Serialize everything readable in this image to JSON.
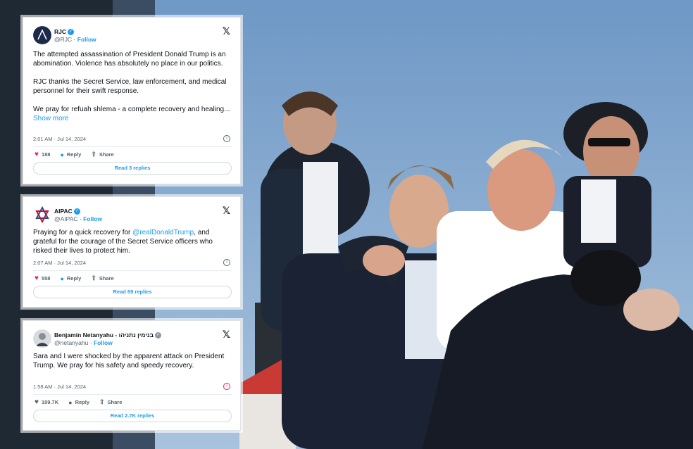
{
  "tweets": [
    {
      "name": "RJC",
      "handle": "@RJC",
      "follow": "Follow",
      "x_logo": "x-logo",
      "paragraphs": [
        "The attempted assassination of President Donald Trump is an abomination. Violence has absolutely no place in our politics.",
        "RJC thanks the Secret Service, law enforcement, and medical personnel for their swift response.",
        "We pray for refuah shlema - a complete recovery and healing..."
      ],
      "show_more": "Show more",
      "timestamp": "2:01 AM · Jul 14, 2024",
      "likes": "188",
      "reply": "Reply",
      "share": "Share",
      "read_replies": "Read 3 replies"
    },
    {
      "name": "AIPAC",
      "handle": "@AIPAC",
      "follow": "Follow",
      "text_before": "Praying for a quick recovery for ",
      "mention": "@realDonaldTrump",
      "text_after": ", and grateful for the courage of the Secret Service officers who risked their lives to protect him.",
      "timestamp": "2:07 AM · Jul 14, 2024",
      "likes": "558",
      "reply": "Reply",
      "share": "Share",
      "read_replies": "Read 69 replies"
    },
    {
      "name": "Benjamin Netanyahu - בנימין נתניהו",
      "handle": "@netanyahu",
      "follow": "Follow",
      "text": "Sara and I were shocked by the apparent attack on President Trump. We pray for his safety and speedy recovery.",
      "timestamp": "1:58 AM · Jul 14, 2024",
      "likes": "109.7K",
      "reply": "Reply",
      "share": "Share",
      "read_replies": "Read 2.7K replies"
    }
  ],
  "colors": {
    "sky": "#7fa3c9",
    "accent": "#1d9bf0",
    "heart": "#f91880"
  }
}
